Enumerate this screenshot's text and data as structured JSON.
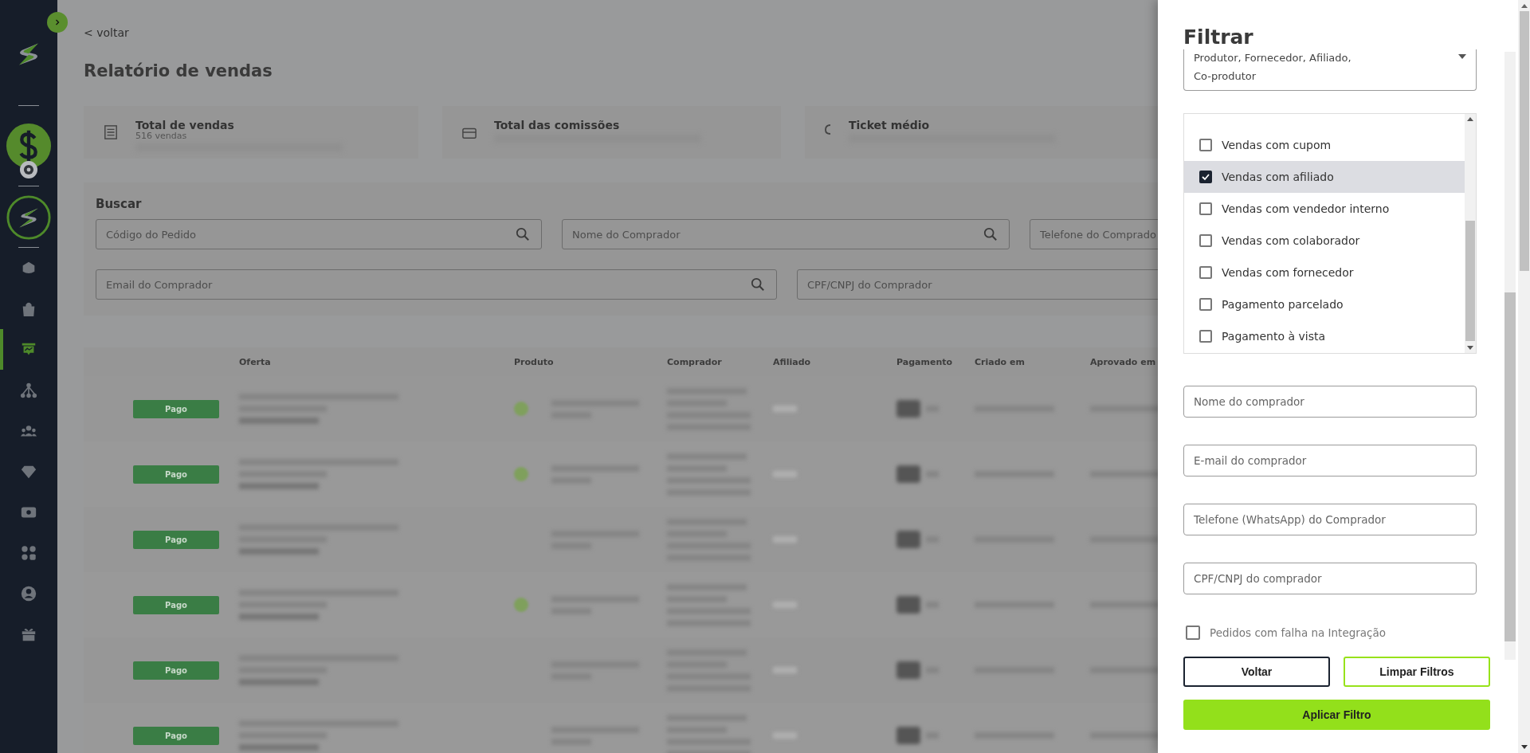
{
  "sidebar": {
    "items": [
      {
        "selected": false
      },
      {
        "selected": false
      },
      {
        "selected": true
      },
      {
        "selected": false
      },
      {
        "selected": false
      },
      {
        "selected": false
      },
      {
        "selected": false
      },
      {
        "selected": false
      },
      {
        "selected": false
      },
      {
        "selected": false
      }
    ]
  },
  "page": {
    "back_link": "< voltar",
    "title": "Relatório de vendas"
  },
  "summary_cards": [
    {
      "title": "Total de vendas",
      "subtitle": "516 vendas"
    },
    {
      "title": "Total das comissões"
    },
    {
      "title": "Ticket médio"
    }
  ],
  "search": {
    "title": "Buscar",
    "fields": [
      {
        "placeholder": "Código do Pedido",
        "search_icon": true
      },
      {
        "placeholder": "Nome do Comprador",
        "search_icon": true
      },
      {
        "placeholder": "Telefone do Comprado"
      },
      {
        "placeholder": "Email do Comprador",
        "search_icon": true
      },
      {
        "placeholder": "CPF/CNPJ do Comprador"
      }
    ]
  },
  "table": {
    "columns": [
      "Oferta",
      "Produto",
      "Comprador",
      "Afiliado",
      "Pagamento",
      "Criado em",
      "Aprovado em"
    ],
    "rows": [
      {
        "status": "Pago",
        "verified": true
      },
      {
        "status": "Pago",
        "verified": true
      },
      {
        "status": "Pago",
        "verified": false
      },
      {
        "status": "Pago",
        "verified": true
      },
      {
        "status": "Pago",
        "verified": false
      },
      {
        "status": "Pago",
        "verified": false
      }
    ]
  },
  "filter_panel": {
    "title": "Filtrar",
    "role_select": {
      "lines": [
        "Produtor, Fornecedor, Afiliado,",
        "Co-produtor"
      ]
    },
    "options": [
      {
        "label": "Vendas com cupom",
        "checked": false,
        "selected": false
      },
      {
        "label": "Vendas com afiliado",
        "checked": true,
        "selected": true
      },
      {
        "label": "Vendas com vendedor interno",
        "checked": false,
        "selected": false
      },
      {
        "label": "Vendas com colaborador",
        "checked": false,
        "selected": false
      },
      {
        "label": "Vendas com fornecedor",
        "checked": false,
        "selected": false
      },
      {
        "label": "Pagamento parcelado",
        "checked": false,
        "selected": false
      },
      {
        "label": "Pagamento à vista",
        "checked": false,
        "selected": false
      }
    ],
    "fields": [
      {
        "placeholder": "Nome do comprador"
      },
      {
        "placeholder": "E-mail do comprador"
      },
      {
        "placeholder": "Telefone (WhatsApp) do Comprador"
      },
      {
        "placeholder": "CPF/CNPJ do comprador"
      }
    ],
    "integration_failure": {
      "label": "Pedidos com falha na Integração",
      "checked": false
    },
    "buttons": [
      {
        "label": "Voltar",
        "kind": "outline-dark"
      },
      {
        "label": "Limpar Filtros",
        "kind": "outline-green"
      },
      {
        "label": "Aplicar Filtro",
        "kind": "primary"
      }
    ]
  }
}
